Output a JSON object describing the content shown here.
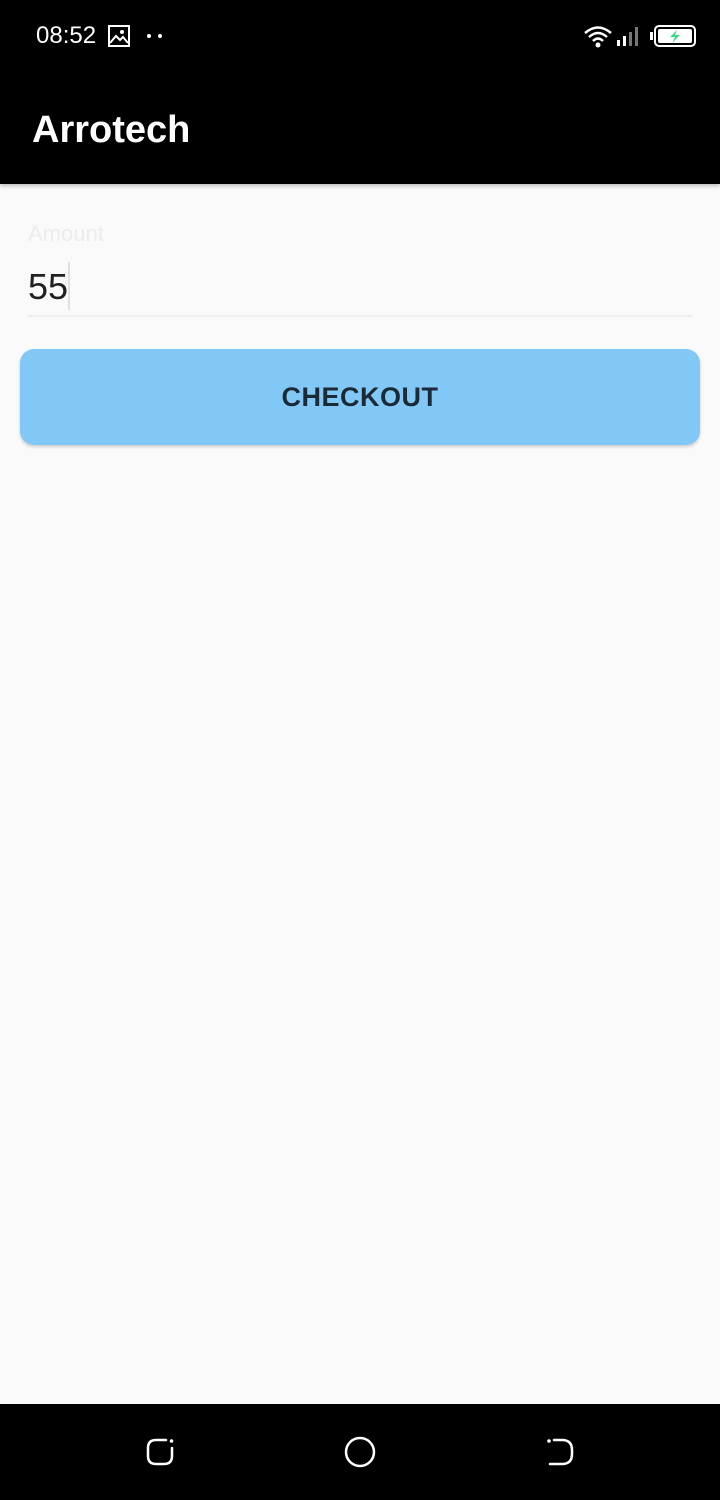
{
  "status_bar": {
    "time": "08:52",
    "icons": [
      "gallery-icon",
      "more-dots-icon",
      "wifi-icon",
      "signal-icon",
      "battery-charging-icon"
    ]
  },
  "app_bar": {
    "title": "Arrotech"
  },
  "form": {
    "amount_label": "Amount",
    "amount_value": "55",
    "checkout_label": "CHECKOUT"
  },
  "nav_bar": {
    "icons": [
      "recent-apps-icon",
      "home-icon",
      "back-icon"
    ]
  },
  "colors": {
    "app_bar": "#000000",
    "background": "#fafafa",
    "button": "#82c8f7",
    "button_text": "#1c2a36",
    "battery_bolt": "#3ddc84"
  }
}
